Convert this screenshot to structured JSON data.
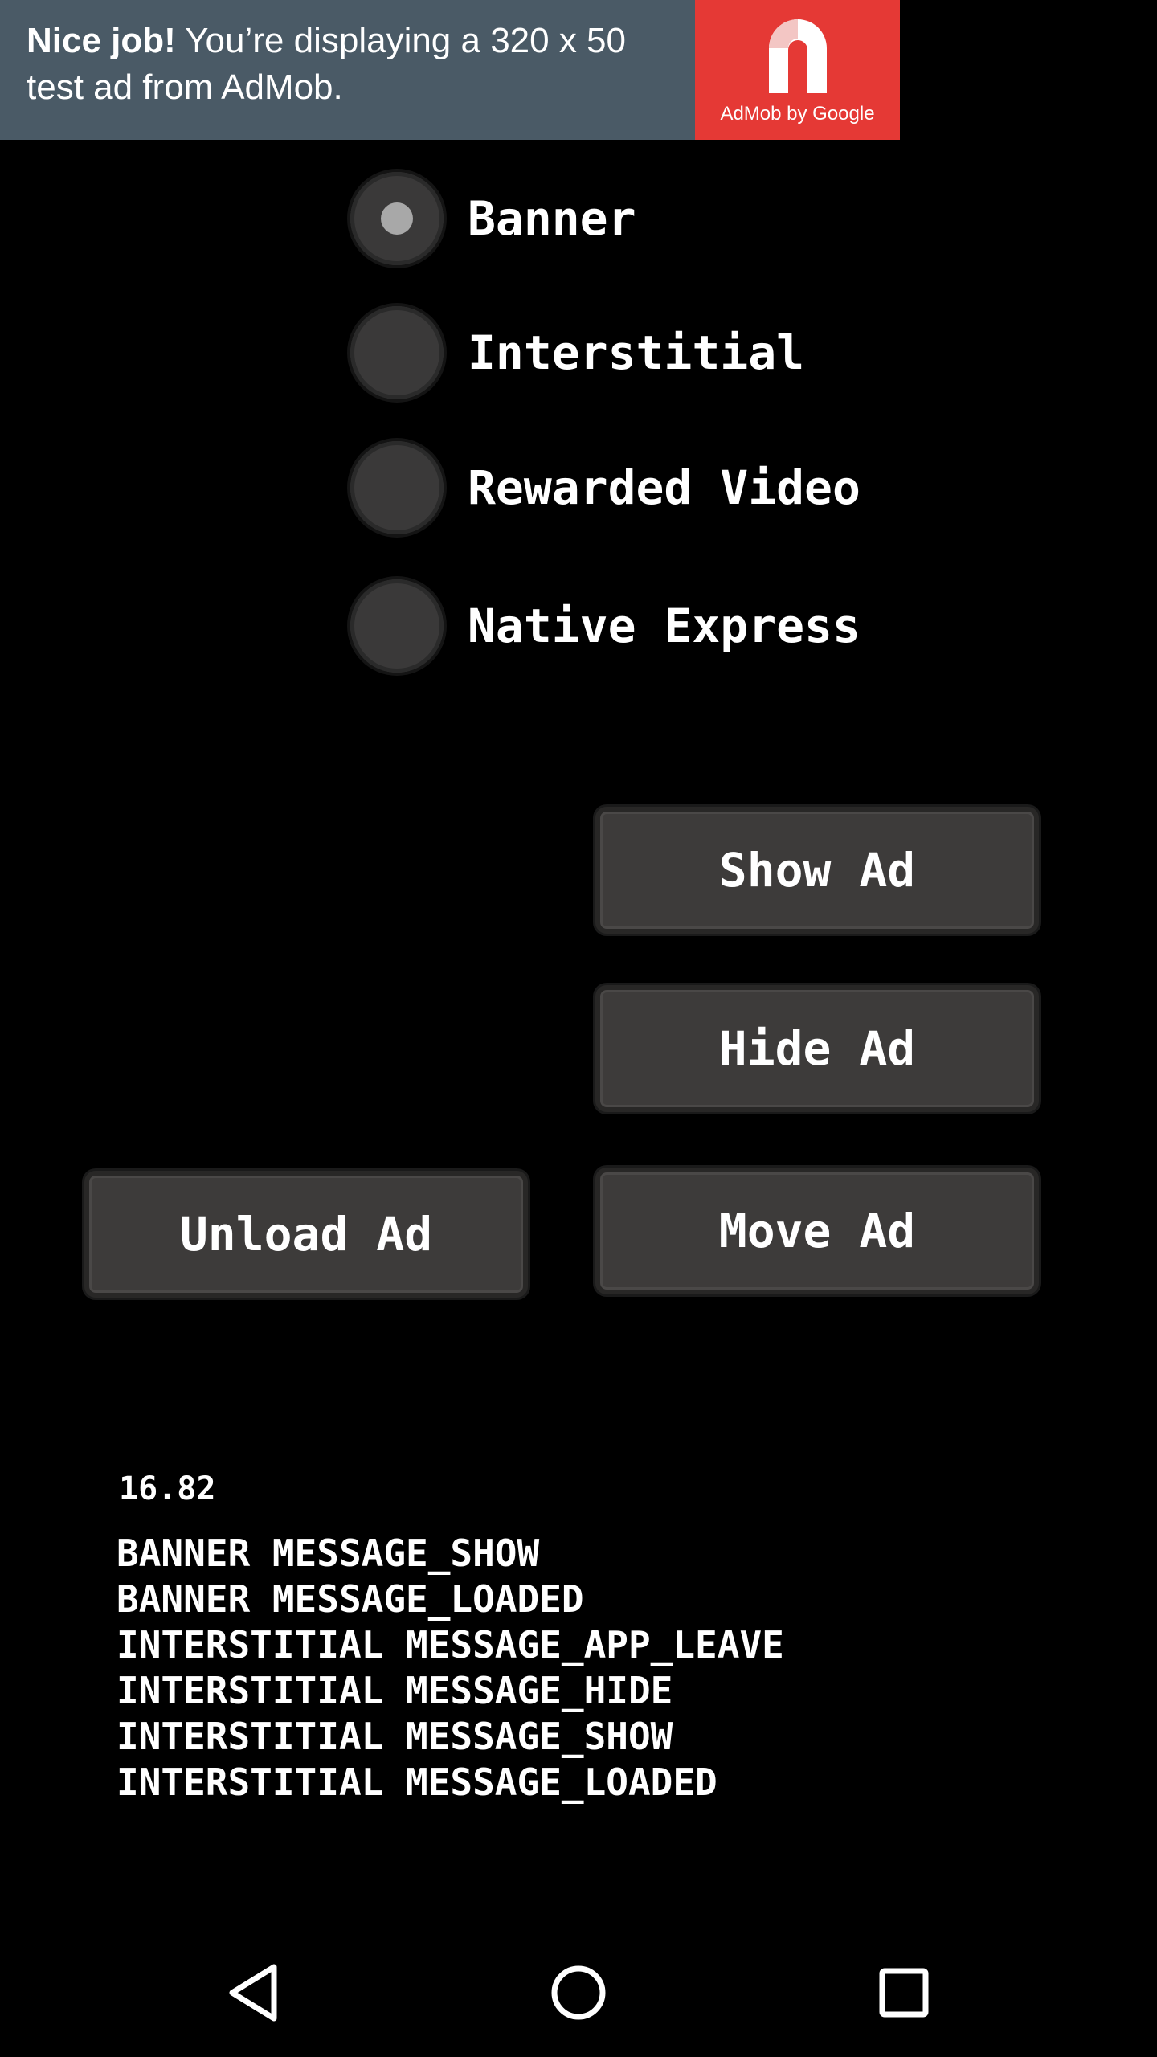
{
  "ad_banner": {
    "headline": "Nice job!",
    "line1": " You’re displaying a 320 x 50",
    "line2": "test ad from AdMob.",
    "logo_caption": "AdMob by Google",
    "colors": {
      "text_bg": "#4a5a66",
      "logo_bg": "#e53935"
    }
  },
  "ad_type_options": [
    {
      "label": "Banner",
      "checked": true
    },
    {
      "label": "Interstitial",
      "checked": false
    },
    {
      "label": "Rewarded Video",
      "checked": false
    },
    {
      "label": "Native Express",
      "checked": false
    }
  ],
  "buttons": {
    "show_ad": "Show Ad",
    "hide_ad": "Hide Ad",
    "unload_ad": "Unload Ad",
    "move_ad": "Move Ad"
  },
  "version": "16.82",
  "log_messages": [
    "BANNER MESSAGE_SHOW",
    "BANNER MESSAGE_LOADED",
    "INTERSTITIAL MESSAGE_APP_LEAVE",
    "INTERSTITIAL MESSAGE_HIDE",
    "INTERSTITIAL MESSAGE_SHOW",
    "INTERSTITIAL MESSAGE_LOADED"
  ],
  "nav_bar": {
    "back_icon": "back-triangle-icon",
    "home_icon": "home-circle-icon",
    "recents_icon": "recents-square-icon"
  }
}
